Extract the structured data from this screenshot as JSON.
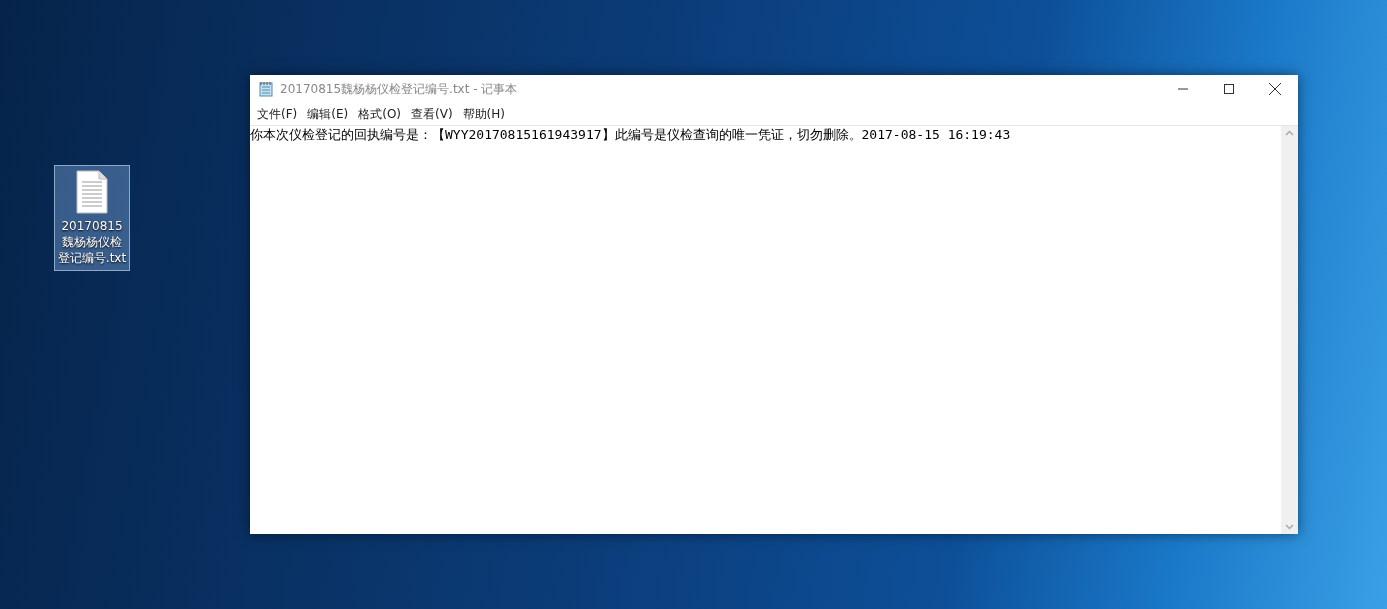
{
  "desktop": {
    "icons": [
      {
        "label": "20170815魏杨杨仪检登记编号.txt",
        "selected": true
      }
    ]
  },
  "window": {
    "title": "20170815魏杨杨仪检登记编号.txt - 记事本",
    "menu": [
      "文件(F)",
      "编辑(E)",
      "格式(O)",
      "查看(V)",
      "帮助(H)"
    ],
    "content": "你本次仪检登记的回执编号是：【WYY20170815161943917】此编号是仪检查询的唯一凭证，切勿删除。2017-08-15 16:19:43"
  }
}
